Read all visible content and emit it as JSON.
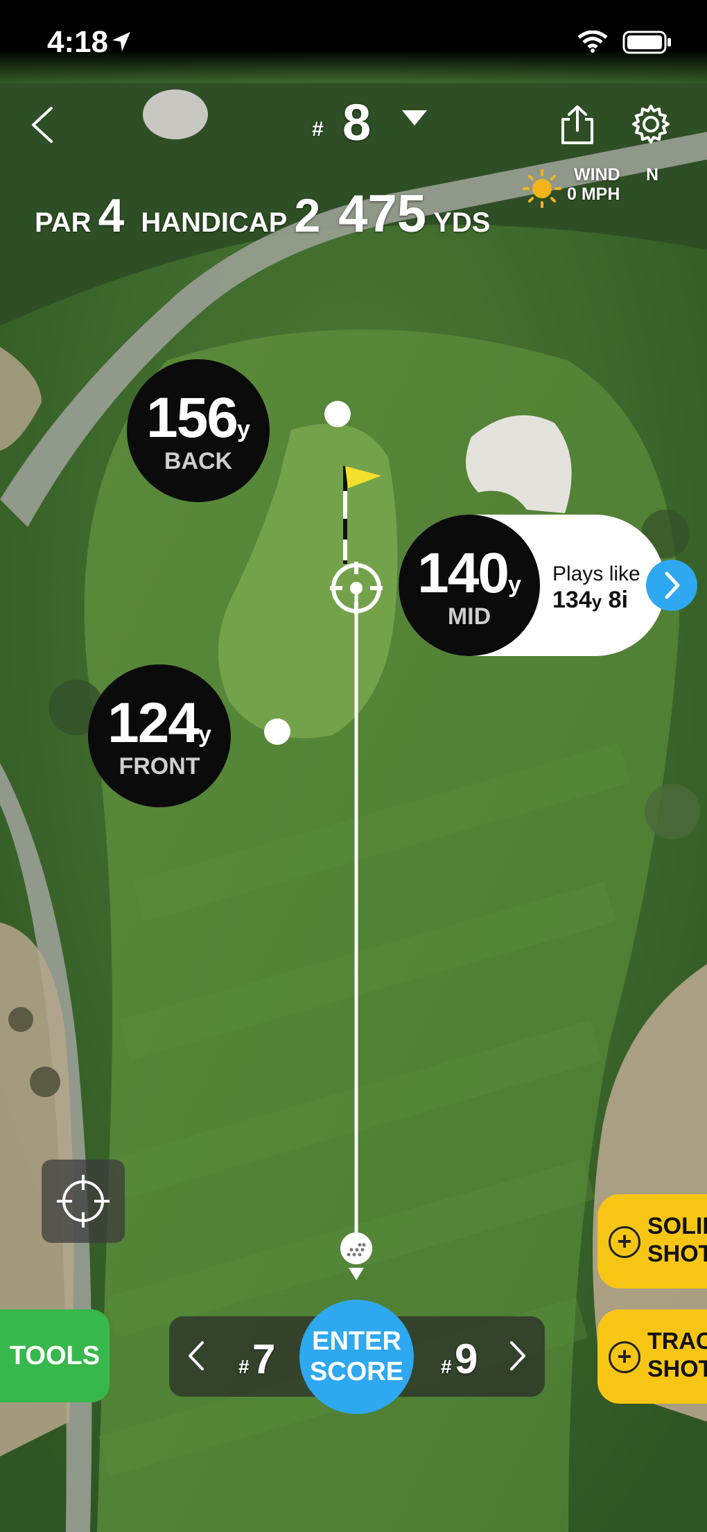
{
  "status_bar": {
    "time": "4:18"
  },
  "hole": {
    "hash": "#",
    "number": "8",
    "par_label": "PAR",
    "par": "4",
    "handicap_label": "HANDICAP",
    "handicap": "2",
    "distance": "475",
    "distance_unit": "YDS"
  },
  "weather": {
    "wind_label": "WIND",
    "wind_speed": "0 MPH",
    "direction": "N"
  },
  "distances": {
    "back": {
      "value": "156",
      "unit": "y",
      "label": "BACK"
    },
    "mid": {
      "value": "140",
      "unit": "y",
      "label": "MID",
      "plays_like_label": "Plays like",
      "plays_like_value": "134",
      "plays_like_unit": "y",
      "plays_like_club": "8i"
    },
    "front": {
      "value": "124",
      "unit": "y",
      "label": "FRONT"
    }
  },
  "buttons": {
    "tools": "TOOLS",
    "enter_score_line1": "ENTER",
    "enter_score_line2": "SCORE",
    "solid_shot_line1": "SOLID",
    "solid_shot_line2": "SHOT",
    "track_shot_line1": "TRACK",
    "track_shot_line2": "SHOT",
    "plus": "+"
  },
  "hole_nav": {
    "hash": "#",
    "prev": "7",
    "next": "9"
  },
  "colors": {
    "accent_blue": "#2ea8f0",
    "tools_green": "#37b84c",
    "shot_yellow": "#f7c615",
    "flag_yellow": "#f2e02c"
  },
  "icons": [
    "back-chevron-icon",
    "dropdown-triangle-icon",
    "share-icon",
    "gear-icon",
    "sun-icon",
    "flag-icon",
    "target-icon",
    "golf-ball-icon",
    "locate-crosshair-icon",
    "chevron-right-icon",
    "chevron-left-icon",
    "plus-icon"
  ]
}
